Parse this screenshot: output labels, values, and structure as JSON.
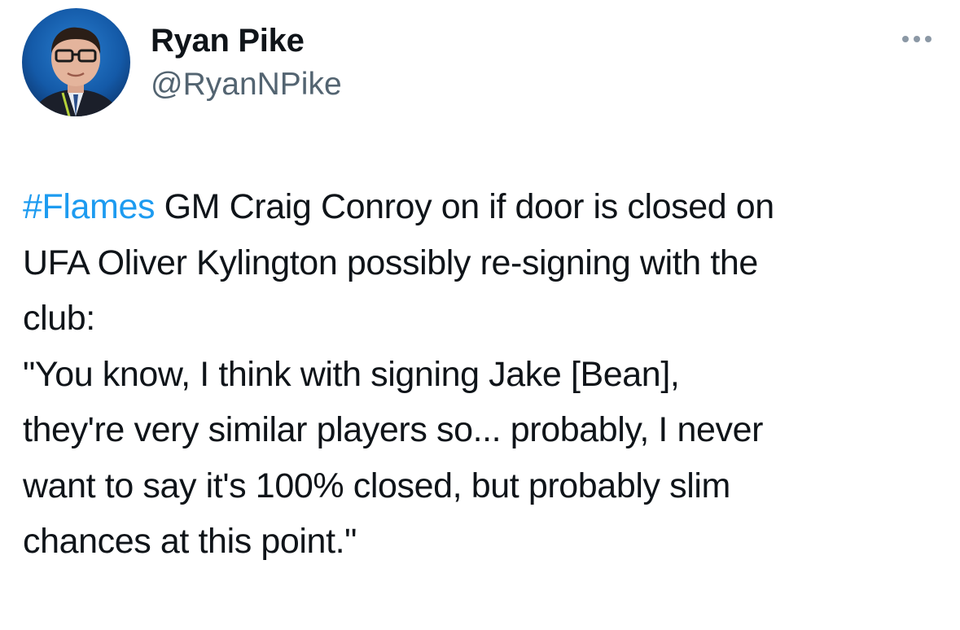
{
  "author": {
    "display_name": "Ryan Pike",
    "handle": "@RyanNPike",
    "avatar_icon": "profile-photo"
  },
  "more_icon": "more-horizontal-icon",
  "tweet": {
    "hashtag": "#Flames",
    "line1_rest": " GM Craig Conroy on if door is closed on",
    "line2": "UFA Oliver Kylington possibly re-signing with the",
    "line3": "club:",
    "line4": "\"You know, I think with signing Jake [Bean],",
    "line5": "they're very similar players so... probably, I never",
    "line6": "want to say it's 100% closed, but probably slim",
    "line7": "chances at this point.\""
  },
  "colors": {
    "link": "#1d9bf0",
    "text": "#0f1419",
    "secondary": "#536471"
  }
}
